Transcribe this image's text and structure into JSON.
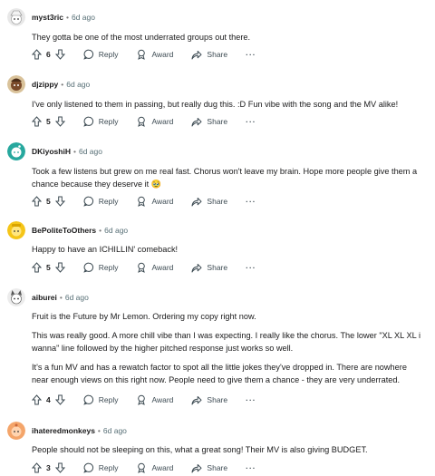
{
  "comments": [
    {
      "username": "myst3ric",
      "age": "6d ago",
      "avatar": "snoo-avatar-white-hat",
      "paragraphs": [
        "They gotta be one of the most underrated groups out there."
      ],
      "votes": "6"
    },
    {
      "username": "djzippy",
      "age": "6d ago",
      "avatar": "snoo-avatar-brown",
      "paragraphs": [
        "I've only listened to them in passing, but really dug this. :D Fun vibe with the song and the MV alike!"
      ],
      "votes": "5"
    },
    {
      "username": "DKiyoshiH",
      "age": "6d ago",
      "avatar": "snoo-avatar-teal",
      "paragraphs": [
        "Took a few listens but grew on me real fast. Chorus won't leave my brain. Hope more people give them a chance because they deserve it 🥹"
      ],
      "votes": "5"
    },
    {
      "username": "BePoliteToOthers",
      "age": "6d ago",
      "avatar": "snoo-avatar-yellow",
      "paragraphs": [
        "Happy to have an ICHILLIN' comeback!"
      ],
      "votes": "5"
    },
    {
      "username": "aiburei",
      "age": "6d ago",
      "avatar": "snoo-avatar-cat-ears",
      "paragraphs": [
        "Fruit is the Future by Mr Lemon. Ordering my copy right now.",
        "This was really good. A more chill vibe than I was expecting. I really like the chorus. The lower \"XL XL XL i wanna\" line followed by the higher pitched response just works so well.",
        "It's a fun MV and has a rewatch factor to spot all the little jokes they've dropped in. There are nowhere near enough views on this right now. People need to give them a chance - they are very underrated."
      ],
      "votes": "4"
    },
    {
      "username": "ihateredmonkeys",
      "age": "6d ago",
      "avatar": "snoo-avatar-orange",
      "paragraphs": [
        "People should not be sleeping on this, what a great song! Their MV is also giving BUDGET."
      ],
      "votes": "3"
    }
  ],
  "labels": {
    "reply": "Reply",
    "award": "Award",
    "share": "Share",
    "more": "···",
    "separator": "•"
  },
  "icons": {
    "upvote": "upvote-icon",
    "downvote": "downvote-icon",
    "reply": "reply-bubble-icon",
    "award": "award-icon",
    "share": "share-arrow-icon",
    "more": "more-options-icon"
  },
  "colors": {
    "text": "#1a1a1b",
    "meta": "#576f76",
    "action": "#3c4a52",
    "background": "#ffffff"
  }
}
